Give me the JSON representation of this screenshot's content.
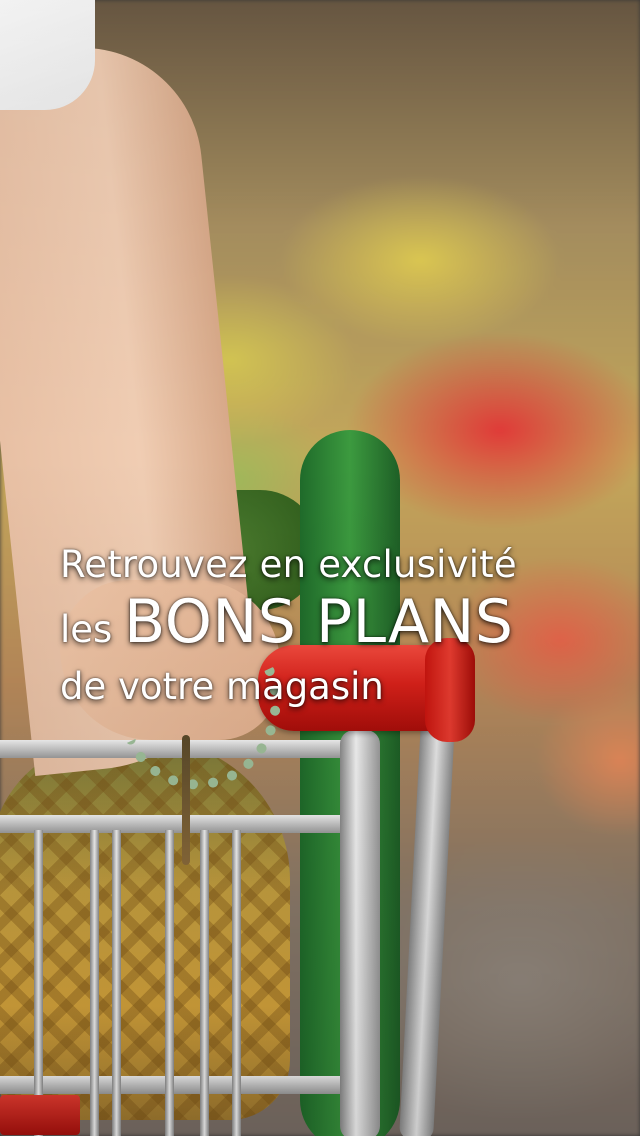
{
  "headline": {
    "line1": "Retrouvez en exclusivité",
    "line2_prefix": "les",
    "line2_highlight": "BONS PLANS",
    "line3": "de votre magasin"
  },
  "background": {
    "icon": "shopping-cart-photo"
  },
  "colors": {
    "text": "#ffffff",
    "handle_red": "#d8211a",
    "cucumber_green": "#3c9a3f"
  }
}
